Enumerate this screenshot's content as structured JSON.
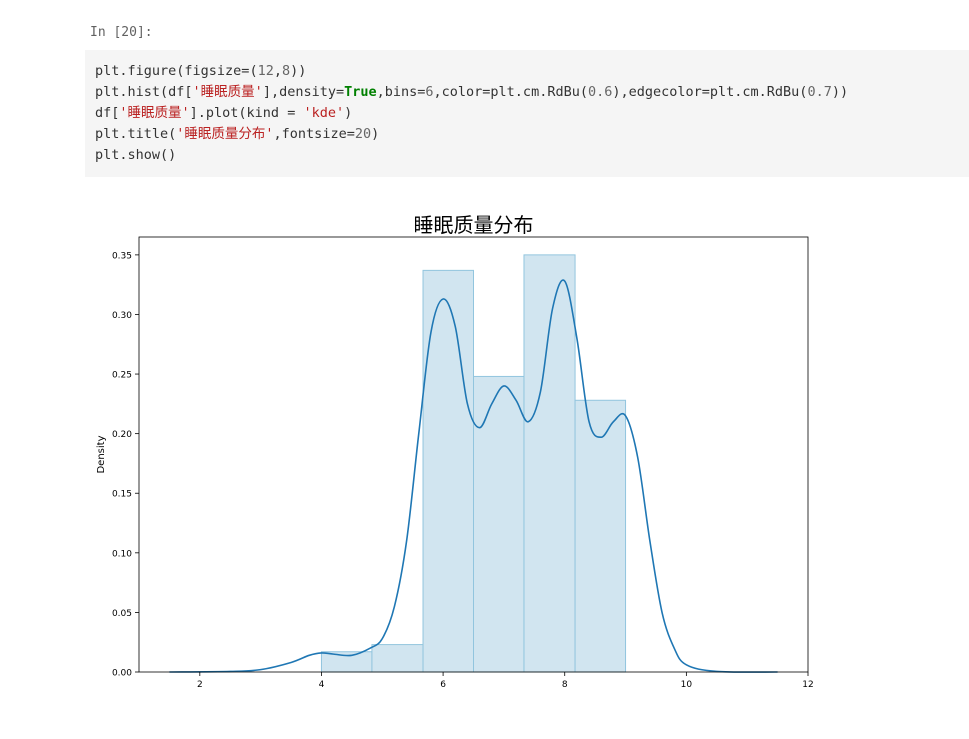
{
  "cell": {
    "prompt": "In [20]:",
    "code_lines": [
      [
        {
          "t": "plt.figure(figsize=",
          "c": ""
        },
        {
          "t": "(",
          "c": ""
        },
        {
          "t": "12",
          "c": "num"
        },
        {
          "t": ",",
          "c": ""
        },
        {
          "t": "8",
          "c": "num"
        },
        {
          "t": "))",
          "c": ""
        }
      ],
      [
        {
          "t": "plt.hist(df[",
          "c": ""
        },
        {
          "t": "'睡眠质量'",
          "c": "str"
        },
        {
          "t": "],density=",
          "c": ""
        },
        {
          "t": "True",
          "c": "kw"
        },
        {
          "t": ",bins=",
          "c": ""
        },
        {
          "t": "6",
          "c": "num"
        },
        {
          "t": ",color=plt.cm.RdBu(",
          "c": ""
        },
        {
          "t": "0.6",
          "c": "num"
        },
        {
          "t": "),edgecolor=plt.cm.RdBu(",
          "c": ""
        },
        {
          "t": "0.7",
          "c": "num"
        },
        {
          "t": "))",
          "c": ""
        }
      ],
      [
        {
          "t": "df[",
          "c": ""
        },
        {
          "t": "'睡眠质量'",
          "c": "str"
        },
        {
          "t": "].plot(kind = ",
          "c": ""
        },
        {
          "t": "'kde'",
          "c": "str"
        },
        {
          "t": ")",
          "c": ""
        }
      ],
      [
        {
          "t": "plt.title(",
          "c": ""
        },
        {
          "t": "'睡眠质量分布'",
          "c": "str"
        },
        {
          "t": ",fontsize=",
          "c": ""
        },
        {
          "t": "20",
          "c": "num"
        },
        {
          "t": ")",
          "c": ""
        }
      ],
      [
        {
          "t": "plt.show()",
          "c": ""
        }
      ]
    ]
  },
  "colors": {
    "bar_fill": "#d1e5f0",
    "bar_edge": "#92c5de",
    "kde_line": "#1f77b4",
    "axis": "#000000"
  },
  "chart_data": {
    "type": "bar",
    "title": "睡眠质量分布",
    "xlabel": "",
    "ylabel": "Density",
    "xlim": [
      1.0,
      12.0
    ],
    "ylim": [
      0.0,
      0.365
    ],
    "xticks": [
      2,
      4,
      6,
      8,
      10,
      12
    ],
    "xtick_labels": [
      "2",
      "4",
      "6",
      "8",
      "10",
      "12"
    ],
    "yticks": [
      0.0,
      0.05,
      0.1,
      0.15,
      0.2,
      0.25,
      0.3,
      0.35
    ],
    "ytick_labels": [
      "0.00",
      "0.05",
      "0.10",
      "0.15",
      "0.20",
      "0.25",
      "0.30",
      "0.35"
    ],
    "histogram": {
      "bin_edges": [
        4.0,
        4.83,
        5.67,
        6.5,
        7.33,
        8.17,
        9.0
      ],
      "density": [
        0.017,
        0.023,
        0.337,
        0.248,
        0.35,
        0.228
      ]
    },
    "series": [
      {
        "kind": "kde",
        "x": [
          1.5,
          2.5,
          3.0,
          3.5,
          3.8,
          4.0,
          4.2,
          4.5,
          4.8,
          5.0,
          5.2,
          5.4,
          5.6,
          5.8,
          6.0,
          6.2,
          6.4,
          6.6,
          6.8,
          7.0,
          7.2,
          7.4,
          7.6,
          7.8,
          8.0,
          8.2,
          8.4,
          8.6,
          8.8,
          9.0,
          9.2,
          9.4,
          9.6,
          9.8,
          10.0,
          10.5,
          11.5
        ],
        "y": [
          0.0,
          0.0005,
          0.002,
          0.008,
          0.014,
          0.016,
          0.015,
          0.014,
          0.02,
          0.028,
          0.055,
          0.11,
          0.2,
          0.285,
          0.313,
          0.29,
          0.225,
          0.205,
          0.225,
          0.24,
          0.228,
          0.21,
          0.235,
          0.305,
          0.328,
          0.28,
          0.21,
          0.197,
          0.21,
          0.215,
          0.18,
          0.11,
          0.05,
          0.02,
          0.006,
          0.0005,
          0.0
        ]
      }
    ]
  }
}
